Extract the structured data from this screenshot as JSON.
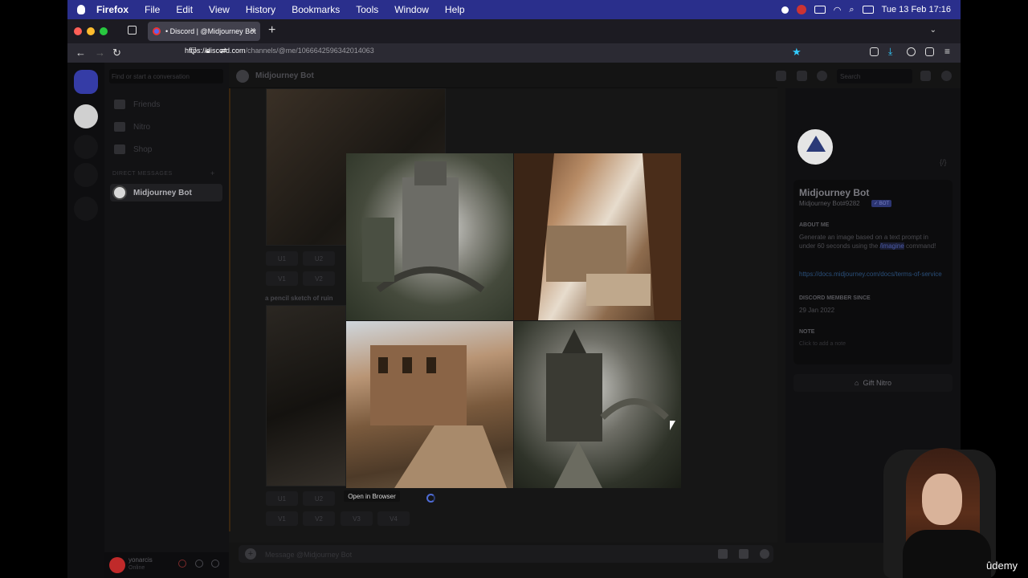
{
  "menubar": {
    "app": "Firefox",
    "items": [
      "File",
      "Edit",
      "View",
      "History",
      "Bookmarks",
      "Tools",
      "Window",
      "Help"
    ],
    "clock": "Tue 13 Feb  17:16"
  },
  "browser": {
    "tab_title": "• Discord | @Midjourney Bot",
    "url_host": "https://discord.com",
    "url_path": "/channels/@me/1066642596342014063"
  },
  "discord": {
    "dm_search_placeholder": "Find or start a conversation",
    "nav": [
      "Friends",
      "Nitro",
      "Shop"
    ],
    "dm_heading": "DIRECT MESSAGES",
    "dm_active": "Midjourney Bot",
    "user_name": "yonarcis",
    "user_status": "Online",
    "channel_name": "Midjourney Bot",
    "header_search": "Search",
    "upscale_buttons": [
      "U1",
      "U2"
    ],
    "variation_buttons": [
      "V1",
      "V2"
    ],
    "bottom_upscale": [
      "U1",
      "U2"
    ],
    "bottom_variation": [
      "V1",
      "V2",
      "V3",
      "V4"
    ],
    "prompt_snippet": "a pencil sketch of ruin",
    "tooltip": "Open in Browser",
    "message_placeholder": "Message @Midjourney Bot"
  },
  "profile": {
    "name": "Midjourney Bot",
    "tag": "Midjourney Bot#9282",
    "badge": "✓ BOT",
    "about_heading": "ABOUT ME",
    "about_1": "Generate an image based on a text prompt in under 60 seconds using the",
    "about_cmd": "/imagine",
    "about_2": "command!",
    "link": "https://docs.midjourney.com/docs/terms-of-service",
    "member_heading": "DISCORD MEMBER SINCE",
    "member_since": "29 Jan 2022",
    "note_heading": "NOTE",
    "note_placeholder": "Click to add a note",
    "gift": "Gift Nitro"
  },
  "watermark": "ûdemy",
  "colors": {
    "menubar": "#2a2f8c",
    "discord_blurple": "#5865f2",
    "firefox_tab": "#42414d"
  }
}
